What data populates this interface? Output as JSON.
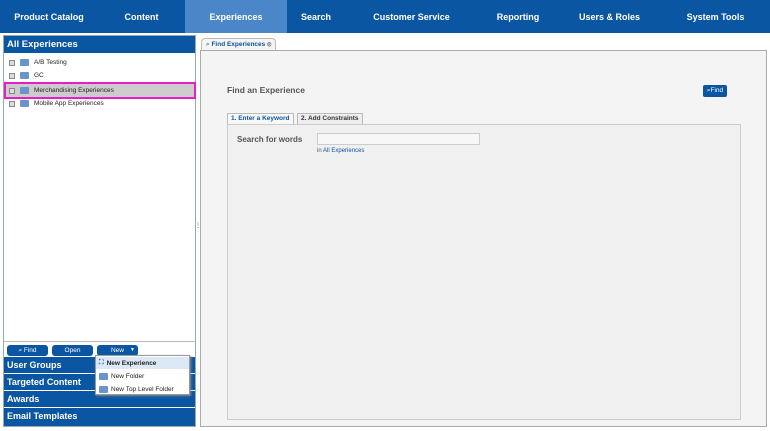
{
  "nav": [
    "Product Catalog",
    "Content",
    "Experiences",
    "Search",
    "Customer Service",
    "Reporting",
    "Users & Roles",
    "System Tools"
  ],
  "left": {
    "title": "All Experiences",
    "tree": [
      "A/B Testing",
      "GC",
      "Merchandising Experiences",
      "Mobile App Experiences"
    ],
    "buttons": {
      "find": "Find",
      "open": "Open",
      "new": "New"
    },
    "menu": [
      "New Experience",
      "New Folder",
      "New Top Level Folder"
    ],
    "sections": [
      "User Groups",
      "Targeted Content",
      "Awards",
      "Email Templates"
    ]
  },
  "main": {
    "tab": "Find Experiences",
    "title": "Find an Experience",
    "find_button": "Find",
    "tabs": [
      "1. Enter a Keyword",
      "2. Add Constraints"
    ],
    "search_label": "Search for words",
    "search_value": "",
    "in_prefix": "in",
    "in_link": "All Experiences"
  }
}
